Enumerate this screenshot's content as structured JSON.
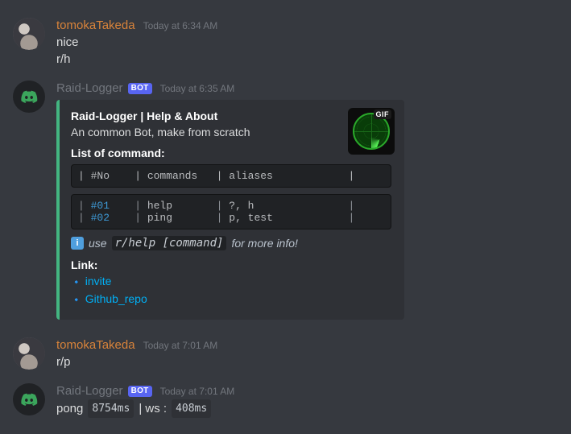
{
  "messages": [
    {
      "author": {
        "name": "tomokaTakeda",
        "type": "user"
      },
      "timestamp": "Today at 6:34 AM",
      "lines": [
        "nice",
        "r/h"
      ]
    },
    {
      "author": {
        "name": "Raid-Logger",
        "type": "bot",
        "tag": "BOT"
      },
      "timestamp": "Today at 6:35 AM",
      "embed": {
        "title": "Raid-Logger | Help & About",
        "description": "An common Bot, make from scratch",
        "list_heading": "List of command:",
        "table_header": "| #No    | commands   | aliases            |",
        "table_rows": [
          {
            "no": "#01",
            "cmd": "help",
            "alias": "?, h"
          },
          {
            "no": "#02",
            "cmd": "ping",
            "alias": "p, test"
          }
        ],
        "info_prefix": "use",
        "info_cmd": "r/help [command]",
        "info_suffix": "for more info!",
        "link_heading": "Link:",
        "links": [
          "invite",
          "Github_repo"
        ],
        "thumb_badge": "GIF"
      }
    },
    {
      "author": {
        "name": "tomokaTakeda",
        "type": "user"
      },
      "timestamp": "Today at 7:01 AM",
      "lines": [
        "r/p"
      ]
    },
    {
      "author": {
        "name": "Raid-Logger",
        "type": "bot",
        "tag": "BOT"
      },
      "timestamp": "Today at 7:01 AM",
      "pong": {
        "label": "pong",
        "latency": "8754ms",
        "sep": "| ws :",
        "ws": "408ms"
      }
    }
  ]
}
